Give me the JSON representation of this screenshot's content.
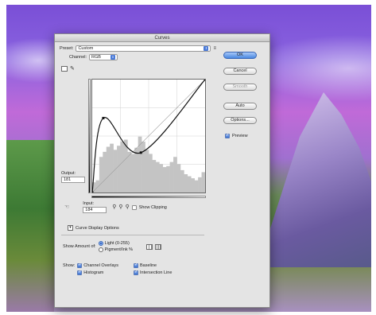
{
  "dialog": {
    "title": "Curves",
    "preset_label": "Preset:",
    "preset_value": "Custom",
    "channel_label": "Channel:",
    "channel_value": "RGB",
    "output_label": "Output:",
    "output_value": "181",
    "input_label": "Input:",
    "input_value": "184",
    "show_clipping_label": "Show Clipping",
    "show_clipping_checked": false,
    "curve_display_label": "Curve Display Options",
    "show_amount_label": "Show Amount of:",
    "light_label": "Light (0-255)",
    "pigment_label": "Pigment/Ink %",
    "light_selected": true,
    "show_label": "Show:",
    "channel_overlays_label": "Channel Overlays",
    "baseline_label": "Baseline",
    "histogram_label": "Histogram",
    "intersection_label": "Intersection Line",
    "preview_label": "Preview",
    "preview_checked": true
  },
  "buttons": {
    "ok": "OK",
    "cancel": "Cancel",
    "smooth": "Smooth",
    "auto": "Auto",
    "options": "Options..."
  },
  "colors": {
    "accent": "#4a88e0",
    "dialog_bg": "#e4e4e4"
  },
  "curve": {
    "points": [
      [
        0,
        0
      ],
      [
        25,
        168
      ],
      [
        110,
        90
      ],
      [
        255,
        255
      ]
    ],
    "histogram": [
      10,
      12,
      35,
      40,
      45,
      48,
      42,
      46,
      50,
      52,
      40,
      38,
      44,
      55,
      50,
      42,
      38,
      32,
      30,
      28,
      25,
      26,
      30,
      35,
      28,
      22,
      18,
      16,
      14,
      12,
      15,
      20
    ]
  },
  "icons": {
    "preset_menu": "preset-options-icon",
    "point_tool": "curve-point-tool-icon",
    "pencil_tool": "pencil-tool-icon",
    "target_adjust": "on-image-adjust-icon",
    "eyedropper_black": "black-eyedropper-icon",
    "eyedropper_gray": "gray-eyedropper-icon",
    "eyedropper_white": "white-eyedropper-icon",
    "grid_simple": "simple-grid-icon",
    "grid_detailed": "detailed-grid-icon"
  }
}
